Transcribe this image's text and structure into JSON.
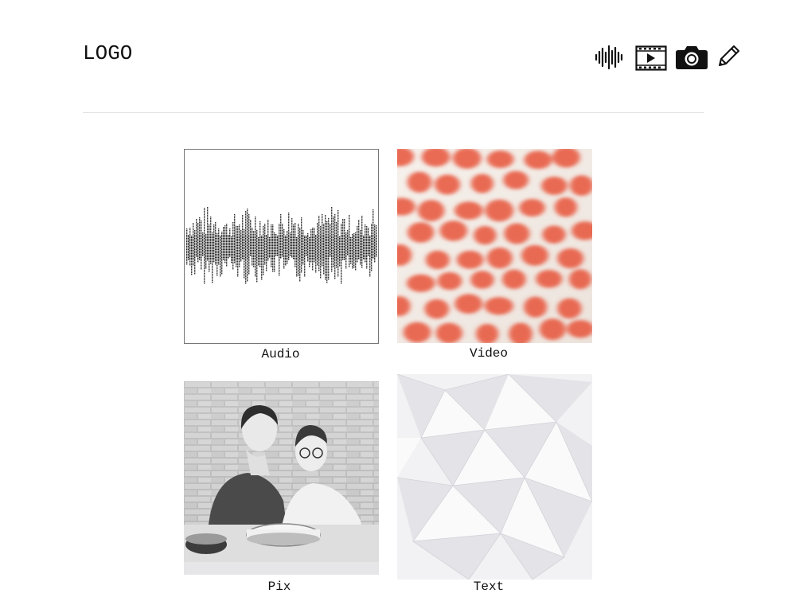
{
  "header": {
    "logo": "LOGO",
    "icons": [
      "audio-waveform-icon",
      "film-play-icon",
      "camera-icon",
      "pencil-icon"
    ]
  },
  "tiles": [
    {
      "label": "Audio"
    },
    {
      "label": "Video"
    },
    {
      "label": "Pix"
    },
    {
      "label": "Text"
    }
  ],
  "colors": {
    "background": "#ffffff",
    "text": "#111111",
    "divider": "#e2e2e2",
    "tomato": "#e8533a"
  }
}
